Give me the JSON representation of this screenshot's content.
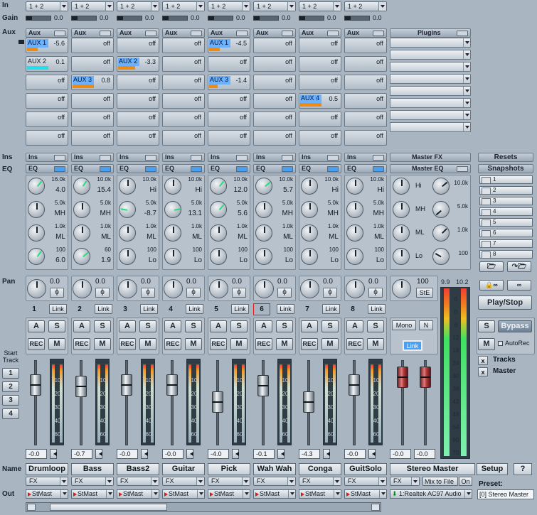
{
  "labels": {
    "in": "In",
    "gain": "Gain",
    "aux": "Aux",
    "ins": "Ins",
    "eq": "EQ",
    "pan": "Pan",
    "start_track": "Start Track",
    "name": "Name",
    "out": "Out"
  },
  "channels": [
    {
      "num": "1",
      "input": "1 + 2",
      "gain": "0.0",
      "aux": [
        {
          "name": "AUX 1",
          "val": "-5.6",
          "active": true,
          "level": 0.5
        },
        {
          "name": "AUX 2",
          "val": "0.1",
          "active": false,
          "level": 1.0,
          "cyan": true
        },
        {
          "name": "",
          "val": "off"
        },
        {
          "name": "",
          "val": "off"
        },
        {
          "name": "",
          "val": "off"
        },
        {
          "name": "",
          "val": "off"
        }
      ],
      "eq": [
        [
          "16.0k",
          "4.0"
        ],
        [
          "5.0k",
          "MH"
        ],
        [
          "1.0k",
          "ML"
        ],
        [
          "100",
          "6.0"
        ]
      ],
      "pan": "0.0",
      "pan_sym": "ϕ",
      "fader": "-0.0",
      "name": "Drumloop",
      "fx": "FX",
      "out": "StMast",
      "fpos": 0.18
    },
    {
      "num": "2",
      "input": "1 + 2",
      "gain": "0.0",
      "aux": [
        {
          "name": "",
          "val": "off"
        },
        {
          "name": "",
          "val": "off"
        },
        {
          "name": "AUX 3",
          "val": "0.8",
          "active": true,
          "level": 1.0
        },
        {
          "name": "",
          "val": "off"
        },
        {
          "name": "",
          "val": "off"
        },
        {
          "name": "",
          "val": "off"
        }
      ],
      "eq": [
        [
          "10.0k",
          "15.4"
        ],
        [
          "5.0k",
          "MH"
        ],
        [
          "1.0k",
          "ML"
        ],
        [
          "60",
          "1.9"
        ]
      ],
      "pan": "0.0",
      "pan_sym": "ϕ",
      "fader": "-0.7",
      "name": "Bass",
      "fx": "FX",
      "out": "StMast",
      "fpos": 0.2
    },
    {
      "num": "3",
      "input": "1 + 2",
      "gain": "0.0",
      "aux": [
        {
          "name": "",
          "val": "off"
        },
        {
          "name": "AUX 2",
          "val": "-3.3",
          "active": true,
          "level": 0.8
        },
        {
          "name": "",
          "val": "off"
        },
        {
          "name": "",
          "val": "off"
        },
        {
          "name": "",
          "val": "off"
        },
        {
          "name": "",
          "val": "off"
        }
      ],
      "eq": [
        [
          "10.0k",
          "Hi"
        ],
        [
          "5.0k",
          "-8.7"
        ],
        [
          "1.0k",
          "ML"
        ],
        [
          "100",
          "Lo"
        ]
      ],
      "pan": "0.0",
      "pan_sym": "ϕ",
      "fader": "-0.0",
      "name": "Bass2",
      "fx": "FX",
      "out": "StMast",
      "fpos": 0.18
    },
    {
      "num": "4",
      "input": "1 + 2",
      "gain": "0.0",
      "aux": [
        {
          "name": "",
          "val": "off"
        },
        {
          "name": "",
          "val": "off"
        },
        {
          "name": "",
          "val": "off"
        },
        {
          "name": "",
          "val": "off"
        },
        {
          "name": "",
          "val": "off"
        },
        {
          "name": "",
          "val": "off"
        }
      ],
      "eq": [
        [
          "10.0k",
          "Hi"
        ],
        [
          "5.0k",
          "13.1"
        ],
        [
          "1.0k",
          "ML"
        ],
        [
          "100",
          "Lo"
        ]
      ],
      "pan": "0.0",
      "pan_sym": "ϕ",
      "fader": "-0.0",
      "name": "Guitar",
      "fx": "FX",
      "out": "StMast",
      "fpos": 0.18
    },
    {
      "num": "5",
      "input": "1 + 2",
      "gain": "0.0",
      "aux": [
        {
          "name": "AUX 1",
          "val": "-4.5",
          "active": true,
          "level": 0.5
        },
        {
          "name": "",
          "val": "off"
        },
        {
          "name": "AUX 3",
          "val": "-1.4",
          "active": true,
          "level": 0.4
        },
        {
          "name": "",
          "val": "off"
        },
        {
          "name": "",
          "val": "off"
        },
        {
          "name": "",
          "val": "off"
        }
      ],
      "eq": [
        [
          "10.0k",
          "12.0"
        ],
        [
          "5.0k",
          "5.6"
        ],
        [
          "1.0k",
          "ML"
        ],
        [
          "100",
          "Lo"
        ]
      ],
      "pan": "0.0",
      "pan_sym": "ϕ",
      "fader": "-4.0",
      "name": "Pick",
      "fx": "FX",
      "out": "StMast",
      "fpos": 0.4
    },
    {
      "num": "6",
      "input": "1 + 2",
      "gain": "0.0",
      "aux": [
        {
          "name": "",
          "val": "off"
        },
        {
          "name": "",
          "val": "off"
        },
        {
          "name": "",
          "val": "off"
        },
        {
          "name": "",
          "val": "off"
        },
        {
          "name": "",
          "val": "off"
        },
        {
          "name": "",
          "val": "off"
        }
      ],
      "eq": [
        [
          "10.0k",
          "5.7"
        ],
        [
          "5.0k",
          "MH"
        ],
        [
          "1.0k",
          "ML"
        ],
        [
          "100",
          "Lo"
        ]
      ],
      "pan": "0.0",
      "pan_sym": "ϕ",
      "fader": "-0.1",
      "name": "Wah Wah",
      "fx": "FX",
      "out": "StMast",
      "fpos": 0.19,
      "selected": true
    },
    {
      "num": "7",
      "input": "1 + 2",
      "gain": "0.0",
      "aux": [
        {
          "name": "",
          "val": "off"
        },
        {
          "name": "",
          "val": "off"
        },
        {
          "name": "",
          "val": "off"
        },
        {
          "name": "AUX 4",
          "val": "0.5",
          "active": true,
          "level": 1.0
        },
        {
          "name": "",
          "val": "off"
        },
        {
          "name": "",
          "val": "off"
        }
      ],
      "eq": [
        [
          "10.0k",
          "Hi"
        ],
        [
          "5.0k",
          "MH"
        ],
        [
          "1.0k",
          "ML"
        ],
        [
          "100",
          "Lo"
        ]
      ],
      "pan": "0.0",
      "pan_sym": "ϕ",
      "fader": "-4.3",
      "name": "Conga",
      "fx": "FX",
      "out": "StMast",
      "fpos": 0.4
    },
    {
      "num": "8",
      "input": "1 + 2",
      "gain": "0.0",
      "aux": [
        {
          "name": "",
          "val": "off"
        },
        {
          "name": "",
          "val": "off"
        },
        {
          "name": "",
          "val": "off"
        },
        {
          "name": "",
          "val": "off"
        },
        {
          "name": "",
          "val": "off"
        },
        {
          "name": "",
          "val": "off"
        }
      ],
      "eq": [
        [
          "10.0k",
          "Hi"
        ],
        [
          "5.0k",
          "MH"
        ],
        [
          "1.0k",
          "ML"
        ],
        [
          "100",
          "Lo"
        ]
      ],
      "pan": "0.0",
      "pan_sym": "ϕ",
      "fader": "-0.0",
      "name": "GuitSolo",
      "fx": "FX",
      "out": "StMast",
      "fpos": 0.18
    }
  ],
  "buttons": {
    "a": "A",
    "s": "S",
    "rec": "REC",
    "m": "M",
    "link": "Link"
  },
  "master": {
    "plugins": "Plugins",
    "fx": "Master FX",
    "eq": "Master EQ",
    "eq_labels": [
      "Hi",
      "MH",
      "ML",
      "Lo"
    ],
    "eq_freq": [
      "10.0k",
      "5.0k",
      "1.0k",
      "100"
    ],
    "pan": "100",
    "pan_mode": "StE",
    "mono": "Mono",
    "n": "N",
    "link": "Link",
    "fader_l": "-0.0",
    "fader_r": "-0.0",
    "name": "Stereo Master",
    "fx_sel": "FX",
    "mix": "Mix to File",
    "mix_state": "On",
    "out": "1:Realtek AC97 Audio",
    "meter_top_l": "9.9",
    "meter_top_r": "10.2"
  },
  "right": {
    "resets": "Resets",
    "snapshots": "Snapshots",
    "snaps": [
      "1",
      "2",
      "3",
      "4",
      "5",
      "6",
      "7",
      "8"
    ],
    "playstop": "Play/Stop",
    "s": "S",
    "bypass": "Bypass",
    "m": "M",
    "autorec": "AutoRec",
    "tracks": "Tracks",
    "master": "Master",
    "x": "x",
    "setup": "Setup",
    "help": "?",
    "preset_label": "Preset:",
    "preset": "[0] Stereo Master"
  },
  "start_track": [
    "1",
    "2",
    "3",
    "4"
  ],
  "scale": [
    "6",
    "0",
    "6",
    "12",
    "18",
    "24",
    "30",
    "36",
    "42",
    "48",
    "54",
    "60",
    "70"
  ],
  "ch_scale": [
    "10",
    "20",
    "30",
    "40",
    "60"
  ]
}
